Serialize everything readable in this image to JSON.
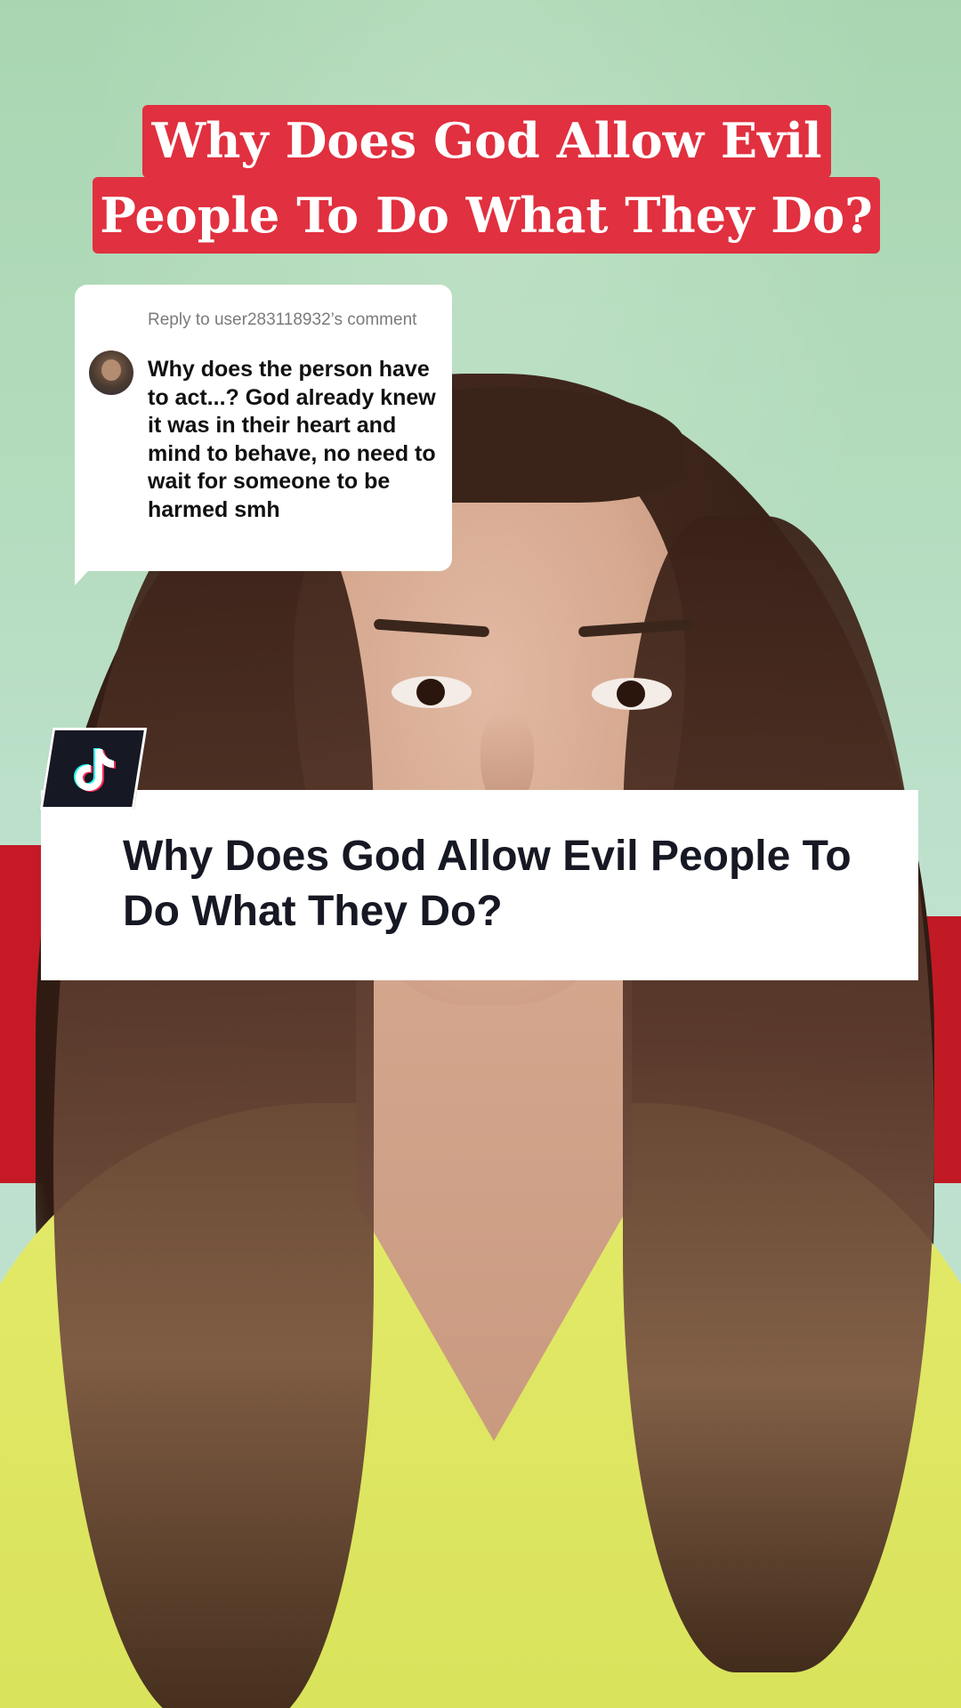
{
  "title_banner": {
    "line1": "Why Does God Allow Evil",
    "line2": "People To Do What They Do?"
  },
  "reply": {
    "header": "Reply to user283118932’s comment",
    "comment": "Why does the person have to act...? God already knew it was in their heart and mind to behave, no need to wait for someone to be harmed smh"
  },
  "caption": {
    "text": "Why Does God Allow Evil People To Do What They Do?"
  },
  "icons": {
    "badge": "tiktok-logo-icon",
    "avatar": "commenter-avatar"
  },
  "colors": {
    "banner_red": "#e1303f",
    "caption_text": "#161823",
    "badge_bg": "#161823"
  }
}
